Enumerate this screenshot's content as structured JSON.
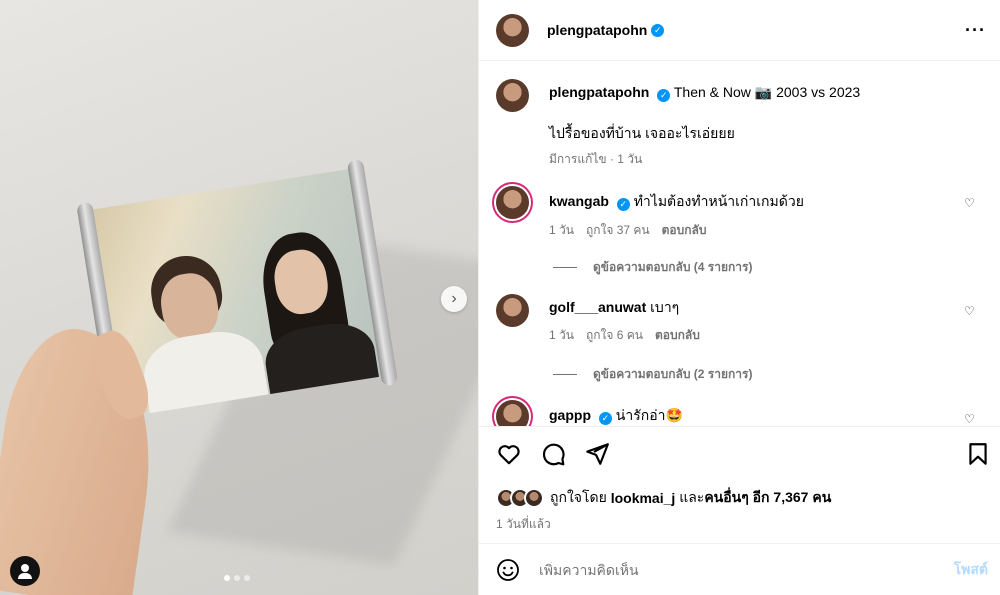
{
  "post": {
    "username": "plengpatapohn",
    "caption_line1": "Then & Now 📷 2003 vs 2023",
    "caption_line2": "ไปรื้อของที่บ้าน เจออะไรเอ่ยยย",
    "caption_meta": "มีการแก้ไข · 1 วัน",
    "carousel_dots": 3,
    "carousel_active": 0
  },
  "comments": [
    {
      "username": "kwangab",
      "verified": true,
      "text": "ทำไมต้องทำหน้าเก่าเกมด้วย",
      "time": "1 วัน",
      "likes": "ถูกใจ 37 คน",
      "reply": "ตอบกลับ",
      "view_replies": "ดูข้อความตอบกลับ (4 รายการ)"
    },
    {
      "username": "golf___anuwat",
      "verified": false,
      "text": "เบาๆ",
      "time": "1 วัน",
      "likes": "ถูกใจ 6 คน",
      "reply": "ตอบกลับ",
      "view_replies": "ดูข้อความตอบกลับ (2 รายการ)"
    },
    {
      "username": "gappp",
      "verified": true,
      "text": "น่ารักอ่า🤩"
    }
  ],
  "likes": {
    "prefix": "ถูกใจโดย",
    "user": "lookmai_j",
    "middle": "และ",
    "others": "คนอื่นๆ อีก 7,367 คน"
  },
  "posted_ago": "1 วันที่แล้ว",
  "add_comment": {
    "placeholder": "เพิ่มความคิดเห็น",
    "post_label": "โพสต์"
  },
  "icons": {
    "more": "more-options-icon",
    "like": "heart-icon",
    "comment": "comment-icon",
    "share": "share-icon",
    "save": "bookmark-icon",
    "emoji": "emoji-icon",
    "verified": "verified-badge-icon"
  },
  "colors": {
    "verified": "#0095f6",
    "muted": "#737373",
    "post_button": "#b3dbff"
  }
}
